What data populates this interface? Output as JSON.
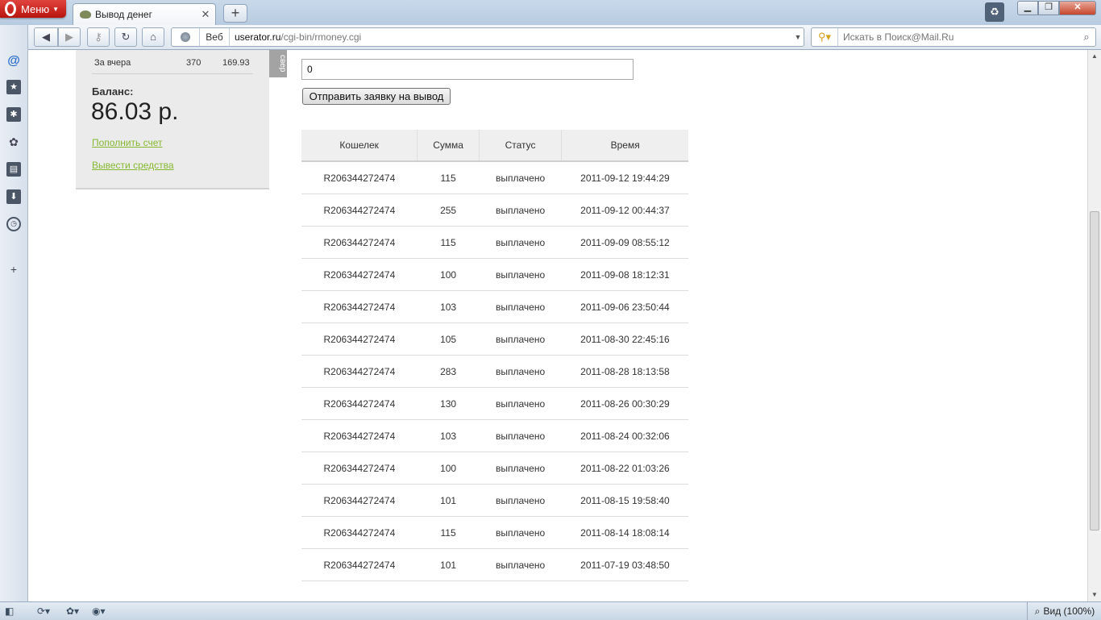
{
  "browser": {
    "menu_label": "Меню",
    "tab_title": "Вывод денег",
    "tab_close": "✕",
    "new_tab": "+",
    "address_mode": "Веб",
    "url_host": "userator.ru",
    "url_path": "/cgi-bin/rmoney.cgi",
    "search_placeholder": "Искать в Поиск@Mail.Ru",
    "zoom_label": "Вид (100%)"
  },
  "sidebar": {
    "stats_row": {
      "label": "За вчера",
      "count": "370",
      "amount": "169.93"
    },
    "balance_label": "Баланс:",
    "balance_value": "86.03 р.",
    "topup_link": "Пополнить счет",
    "withdraw_link": "Вывести средства",
    "side_tab_label": "свер"
  },
  "withdraw_form": {
    "amount_value": "0",
    "submit_label": "Отправить заявку на вывод"
  },
  "table": {
    "headers": [
      "Кошелек",
      "Сумма",
      "Статус",
      "Время"
    ],
    "rows": [
      {
        "wallet": "R206344272474",
        "sum": "115",
        "status": "выплачено",
        "time": "2011-09-12 19:44:29"
      },
      {
        "wallet": "R206344272474",
        "sum": "255",
        "status": "выплачено",
        "time": "2011-09-12 00:44:37"
      },
      {
        "wallet": "R206344272474",
        "sum": "115",
        "status": "выплачено",
        "time": "2011-09-09 08:55:12"
      },
      {
        "wallet": "R206344272474",
        "sum": "100",
        "status": "выплачено",
        "time": "2011-09-08 18:12:31"
      },
      {
        "wallet": "R206344272474",
        "sum": "103",
        "status": "выплачено",
        "time": "2011-09-06 23:50:44"
      },
      {
        "wallet": "R206344272474",
        "sum": "105",
        "status": "выплачено",
        "time": "2011-08-30 22:45:16"
      },
      {
        "wallet": "R206344272474",
        "sum": "283",
        "status": "выплачено",
        "time": "2011-08-28 18:13:58"
      },
      {
        "wallet": "R206344272474",
        "sum": "130",
        "status": "выплачено",
        "time": "2011-08-26 00:30:29"
      },
      {
        "wallet": "R206344272474",
        "sum": "103",
        "status": "выплачено",
        "time": "2011-08-24 00:32:06"
      },
      {
        "wallet": "R206344272474",
        "sum": "100",
        "status": "выплачено",
        "time": "2011-08-22 01:03:26"
      },
      {
        "wallet": "R206344272474",
        "sum": "101",
        "status": "выплачено",
        "time": "2011-08-15 19:58:40"
      },
      {
        "wallet": "R206344272474",
        "sum": "115",
        "status": "выплачено",
        "time": "2011-08-14 18:08:14"
      },
      {
        "wallet": "R206344272474",
        "sum": "101",
        "status": "выплачено",
        "time": "2011-07-19 03:48:50"
      }
    ]
  },
  "colors": {
    "link": "#86b932",
    "menu_button": "#c62a22",
    "sidebar_bg": "#ebebeb",
    "table_header_bg": "#efefef"
  }
}
